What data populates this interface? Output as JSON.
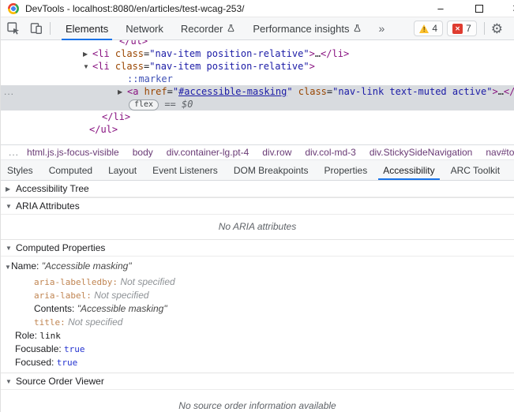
{
  "colors": {
    "accent": "#1a73e8",
    "selection": "#d8dbdf",
    "tag": "#881280",
    "attribute": "#994500",
    "value": "#1a1aa6",
    "warning": "#fbc02d",
    "error": "#df3c30"
  },
  "titlebar": {
    "title": "DevTools - localhost:8080/en/articles/test-wcag-253/"
  },
  "icons": {
    "minimize": "–",
    "close": "✕",
    "more_tabs": "»",
    "gear": "⚙",
    "warning_mark": "!",
    "error_x": "✕",
    "ellipsis_gutter": "...",
    "tri_right": "▶",
    "tri_down": "▼"
  },
  "toolbar": {
    "tabs": [
      {
        "label": "Elements",
        "active": true
      },
      {
        "label": "Network",
        "active": false
      },
      {
        "label": "Recorder",
        "active": false
      },
      {
        "label": "Performance insights",
        "active": false
      }
    ],
    "warning_count": "4",
    "error_count": "7"
  },
  "elements_panel": {
    "lines": [
      {
        "tokens": [
          {
            "s": "</ul>"
          }
        ]
      },
      {
        "arrow": "▶",
        "tokens": [
          {
            "s": "<li"
          },
          {
            "s": " class"
          },
          {
            "s": "="
          },
          {
            "s": "\"nav-item position-relative\""
          },
          {
            "s": ">"
          },
          {
            "s": "…"
          },
          {
            "s": "</li>"
          }
        ]
      },
      {
        "arrow": "▼",
        "tokens": [
          {
            "s": "<li"
          },
          {
            "s": " class"
          },
          {
            "s": "="
          },
          {
            "s": "\"nav-item position-relative\""
          },
          {
            "s": ">"
          }
        ]
      },
      {
        "tokens": [
          {
            "s": "::marker"
          }
        ]
      },
      {
        "arrow": "▶",
        "selected": true,
        "tokens": [
          {
            "s": "<a"
          },
          {
            "s": " href"
          },
          {
            "s": "="
          },
          {
            "s": "\""
          },
          {
            "s": "#accessible-masking"
          },
          {
            "s": "\""
          },
          {
            "s": " class"
          },
          {
            "s": "="
          },
          {
            "s": "\"nav-link text-muted active\""
          },
          {
            "s": ">"
          },
          {
            "s": "…"
          },
          {
            "s": "</a>"
          }
        ]
      },
      {
        "selected": true,
        "tokens": [
          {
            "s": "flex"
          },
          {
            "s": " == "
          },
          {
            "s": "$0"
          }
        ]
      },
      {
        "tokens": [
          {
            "s": "</li>"
          }
        ]
      },
      {
        "tokens": [
          {
            "s": "</ul>"
          }
        ]
      }
    ]
  },
  "breadcrumb": {
    "overflow": "...",
    "items": [
      "html.js.js-focus-visible",
      "body",
      "div.container-lg.pt-4",
      "div.row",
      "div.col-md-3",
      "div.StickySideNavigation",
      "nav#toc."
    ]
  },
  "panel_tabs": {
    "items": [
      {
        "label": "Styles",
        "active": false
      },
      {
        "label": "Computed",
        "active": false
      },
      {
        "label": "Layout",
        "active": false
      },
      {
        "label": "Event Listeners",
        "active": false
      },
      {
        "label": "DOM Breakpoints",
        "active": false
      },
      {
        "label": "Properties",
        "active": false
      },
      {
        "label": "Accessibility",
        "active": true
      },
      {
        "label": "ARC Toolkit",
        "active": false
      }
    ]
  },
  "accessibility_pane": {
    "tree_section": "Accessibility Tree",
    "aria_section": "ARIA Attributes",
    "aria_empty": "No ARIA attributes",
    "computed_section": "Computed Properties",
    "source_section": "Source Order Viewer",
    "source_empty": "No source order information available",
    "properties": {
      "name": {
        "label": "Name:",
        "value": "\"Accessible masking\""
      },
      "aria_labelledby": {
        "label": "aria-labelledby:",
        "value": "Not specified"
      },
      "aria_label": {
        "label": "aria-label:",
        "value": "Not specified"
      },
      "contents": {
        "label": "Contents:",
        "value": "\"Accessible masking\""
      },
      "title": {
        "label": "title:",
        "value": "Not specified"
      },
      "role": {
        "label": "Role:",
        "value": "link"
      },
      "focusable": {
        "label": "Focusable:",
        "value": "true"
      },
      "focused": {
        "label": "Focused:",
        "value": "true"
      }
    }
  }
}
